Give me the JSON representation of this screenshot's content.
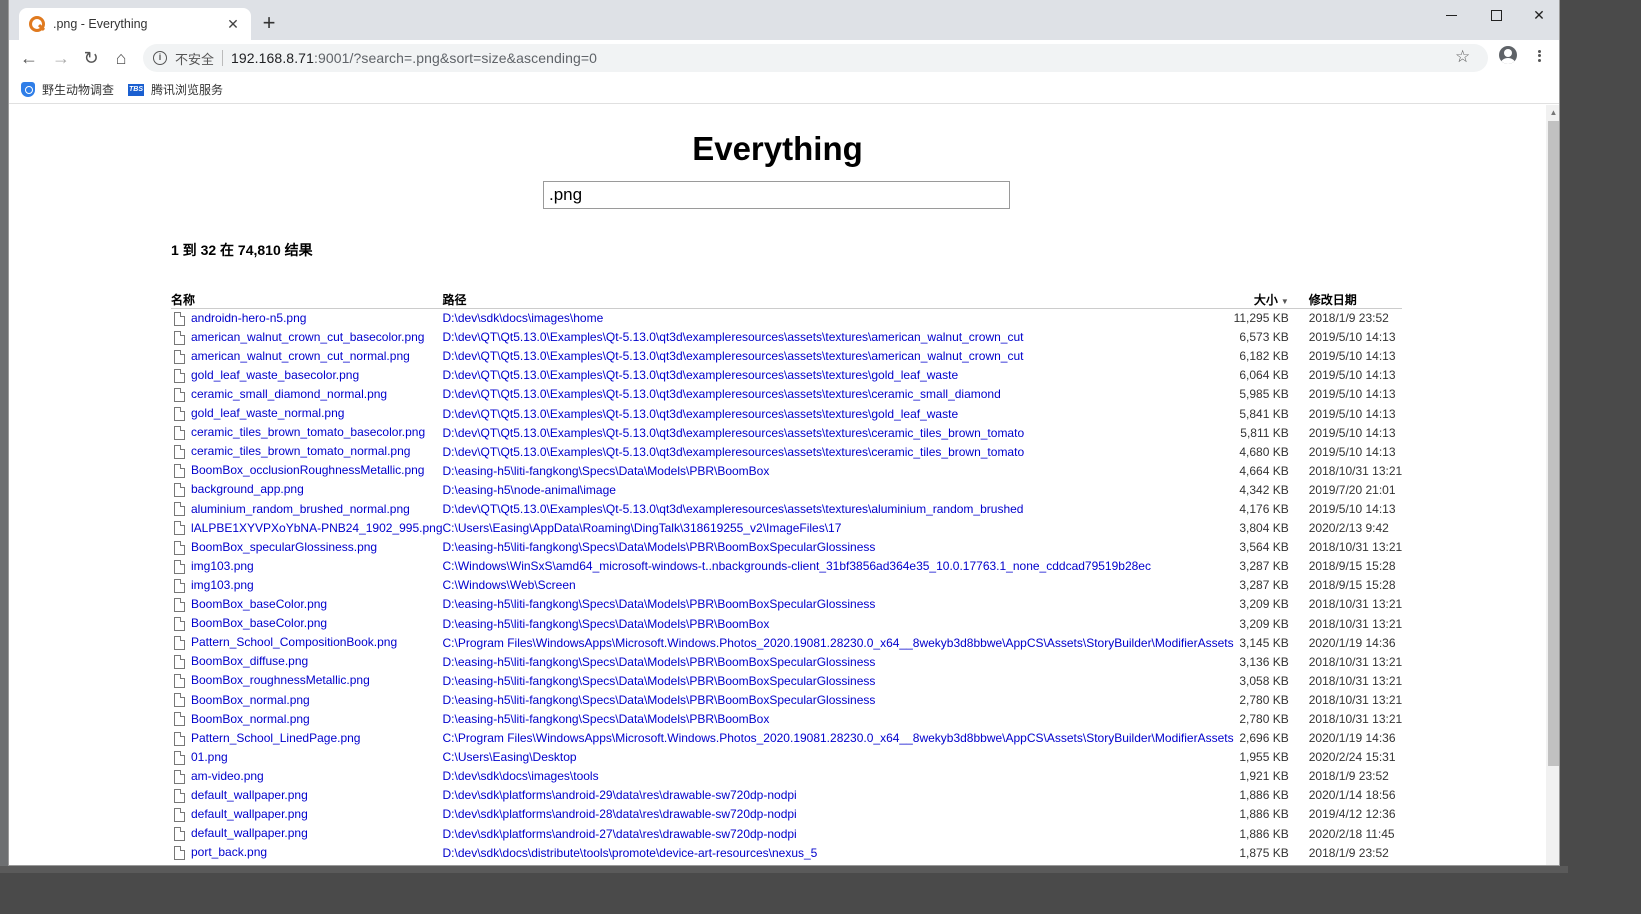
{
  "browser": {
    "tab_title": ".png - Everything",
    "tab_close": "✕",
    "new_tab": "+",
    "insecure_label": "不安全",
    "url_host": "192.168.8.71",
    "url_rest": ":9001/?search=.png&sort=size&ascending=0",
    "bookmarks": [
      {
        "label": "野生动物调查",
        "icon": "shield-icon"
      },
      {
        "label": "腾讯浏览服务",
        "icon": "tbs-icon",
        "icon_text": "TBS"
      }
    ]
  },
  "page": {
    "title": "Everything",
    "search_value": ".png",
    "result_count": "1 到 32 在 74,810 结果",
    "columns": {
      "name": "名称",
      "path": "路径",
      "size": "大小",
      "date": "修改日期"
    },
    "rows": [
      {
        "name": "androidn-hero-n5.png",
        "path": "D:\\dev\\sdk\\docs\\images\\home",
        "size": "11,295 KB",
        "date": "2018/1/9 23:52"
      },
      {
        "name": "american_walnut_crown_cut_basecolor.png",
        "path": "D:\\dev\\QT\\Qt5.13.0\\Examples\\Qt-5.13.0\\qt3d\\exampleresources\\assets\\textures\\american_walnut_crown_cut",
        "size": "6,573 KB",
        "date": "2019/5/10 14:13"
      },
      {
        "name": "american_walnut_crown_cut_normal.png",
        "path": "D:\\dev\\QT\\Qt5.13.0\\Examples\\Qt-5.13.0\\qt3d\\exampleresources\\assets\\textures\\american_walnut_crown_cut",
        "size": "6,182 KB",
        "date": "2019/5/10 14:13"
      },
      {
        "name": "gold_leaf_waste_basecolor.png",
        "path": "D:\\dev\\QT\\Qt5.13.0\\Examples\\Qt-5.13.0\\qt3d\\exampleresources\\assets\\textures\\gold_leaf_waste",
        "size": "6,064 KB",
        "date": "2019/5/10 14:13"
      },
      {
        "name": "ceramic_small_diamond_normal.png",
        "path": "D:\\dev\\QT\\Qt5.13.0\\Examples\\Qt-5.13.0\\qt3d\\exampleresources\\assets\\textures\\ceramic_small_diamond",
        "size": "5,985 KB",
        "date": "2019/5/10 14:13"
      },
      {
        "name": "gold_leaf_waste_normal.png",
        "path": "D:\\dev\\QT\\Qt5.13.0\\Examples\\Qt-5.13.0\\qt3d\\exampleresources\\assets\\textures\\gold_leaf_waste",
        "size": "5,841 KB",
        "date": "2019/5/10 14:13"
      },
      {
        "name": "ceramic_tiles_brown_tomato_basecolor.png",
        "path": "D:\\dev\\QT\\Qt5.13.0\\Examples\\Qt-5.13.0\\qt3d\\exampleresources\\assets\\textures\\ceramic_tiles_brown_tomato",
        "size": "5,811 KB",
        "date": "2019/5/10 14:13"
      },
      {
        "name": "ceramic_tiles_brown_tomato_normal.png",
        "path": "D:\\dev\\QT\\Qt5.13.0\\Examples\\Qt-5.13.0\\qt3d\\exampleresources\\assets\\textures\\ceramic_tiles_brown_tomato",
        "size": "4,680 KB",
        "date": "2019/5/10 14:13"
      },
      {
        "name": "BoomBox_occlusionRoughnessMetallic.png",
        "path": "D:\\easing-h5\\liti-fangkong\\Specs\\Data\\Models\\PBR\\BoomBox",
        "size": "4,664 KB",
        "date": "2018/10/31 13:21"
      },
      {
        "name": "background_app.png",
        "path": "D:\\easing-h5\\node-animal\\image",
        "size": "4,342 KB",
        "date": "2019/7/20 21:01"
      },
      {
        "name": "aluminium_random_brushed_normal.png",
        "path": "D:\\dev\\QT\\Qt5.13.0\\Examples\\Qt-5.13.0\\qt3d\\exampleresources\\assets\\textures\\aluminium_random_brushed",
        "size": "4,176 KB",
        "date": "2019/5/10 14:13"
      },
      {
        "name": "lALPBE1XYVPXoYbNA-PNB24_1902_995.png",
        "path": "C:\\Users\\Easing\\AppData\\Roaming\\DingTalk\\318619255_v2\\ImageFiles\\17",
        "size": "3,804 KB",
        "date": "2020/2/13 9:42"
      },
      {
        "name": "BoomBox_specularGlossiness.png",
        "path": "D:\\easing-h5\\liti-fangkong\\Specs\\Data\\Models\\PBR\\BoomBoxSpecularGlossiness",
        "size": "3,564 KB",
        "date": "2018/10/31 13:21"
      },
      {
        "name": "img103.png",
        "path": "C:\\Windows\\WinSxS\\amd64_microsoft-windows-t..nbackgrounds-client_31bf3856ad364e35_10.0.17763.1_none_cddcad79519b28ec",
        "size": "3,287 KB",
        "date": "2018/9/15 15:28"
      },
      {
        "name": "img103.png",
        "path": "C:\\Windows\\Web\\Screen",
        "size": "3,287 KB",
        "date": "2018/9/15 15:28"
      },
      {
        "name": "BoomBox_baseColor.png",
        "path": "D:\\easing-h5\\liti-fangkong\\Specs\\Data\\Models\\PBR\\BoomBoxSpecularGlossiness",
        "size": "3,209 KB",
        "date": "2018/10/31 13:21"
      },
      {
        "name": "BoomBox_baseColor.png",
        "path": "D:\\easing-h5\\liti-fangkong\\Specs\\Data\\Models\\PBR\\BoomBox",
        "size": "3,209 KB",
        "date": "2018/10/31 13:21"
      },
      {
        "name": "Pattern_School_CompositionBook.png",
        "path": "C:\\Program Files\\WindowsApps\\Microsoft.Windows.Photos_2020.19081.28230.0_x64__8wekyb3d8bbwe\\AppCS\\Assets\\StoryBuilder\\ModifierAssets",
        "size": "3,145 KB",
        "date": "2020/1/19 14:36"
      },
      {
        "name": "BoomBox_diffuse.png",
        "path": "D:\\easing-h5\\liti-fangkong\\Specs\\Data\\Models\\PBR\\BoomBoxSpecularGlossiness",
        "size": "3,136 KB",
        "date": "2018/10/31 13:21"
      },
      {
        "name": "BoomBox_roughnessMetallic.png",
        "path": "D:\\easing-h5\\liti-fangkong\\Specs\\Data\\Models\\PBR\\BoomBoxSpecularGlossiness",
        "size": "3,058 KB",
        "date": "2018/10/31 13:21"
      },
      {
        "name": "BoomBox_normal.png",
        "path": "D:\\easing-h5\\liti-fangkong\\Specs\\Data\\Models\\PBR\\BoomBoxSpecularGlossiness",
        "size": "2,780 KB",
        "date": "2018/10/31 13:21"
      },
      {
        "name": "BoomBox_normal.png",
        "path": "D:\\easing-h5\\liti-fangkong\\Specs\\Data\\Models\\PBR\\BoomBox",
        "size": "2,780 KB",
        "date": "2018/10/31 13:21"
      },
      {
        "name": "Pattern_School_LinedPage.png",
        "path": "C:\\Program Files\\WindowsApps\\Microsoft.Windows.Photos_2020.19081.28230.0_x64__8wekyb3d8bbwe\\AppCS\\Assets\\StoryBuilder\\ModifierAssets",
        "size": "2,696 KB",
        "date": "2020/1/19 14:36"
      },
      {
        "name": "01.png",
        "path": "C:\\Users\\Easing\\Desktop",
        "size": "1,955 KB",
        "date": "2020/2/24 15:31"
      },
      {
        "name": "am-video.png",
        "path": "D:\\dev\\sdk\\docs\\images\\tools",
        "size": "1,921 KB",
        "date": "2018/1/9 23:52"
      },
      {
        "name": "default_wallpaper.png",
        "path": "D:\\dev\\sdk\\platforms\\android-29\\data\\res\\drawable-sw720dp-nodpi",
        "size": "1,886 KB",
        "date": "2020/1/14 18:56"
      },
      {
        "name": "default_wallpaper.png",
        "path": "D:\\dev\\sdk\\platforms\\android-28\\data\\res\\drawable-sw720dp-nodpi",
        "size": "1,886 KB",
        "date": "2019/4/12 12:36"
      },
      {
        "name": "default_wallpaper.png",
        "path": "D:\\dev\\sdk\\platforms\\android-27\\data\\res\\drawable-sw720dp-nodpi",
        "size": "1,886 KB",
        "date": "2020/2/18 11:45"
      },
      {
        "name": "port_back.png",
        "path": "D:\\dev\\sdk\\docs\\distribute\\tools\\promote\\device-art-resources\\nexus_5",
        "size": "1,875 KB",
        "date": "2018/1/9 23:52"
      }
    ]
  },
  "colors": {
    "link": "#0000cc",
    "tabstrip": "#dee1e6",
    "omnibox": "#f1f3f4"
  }
}
